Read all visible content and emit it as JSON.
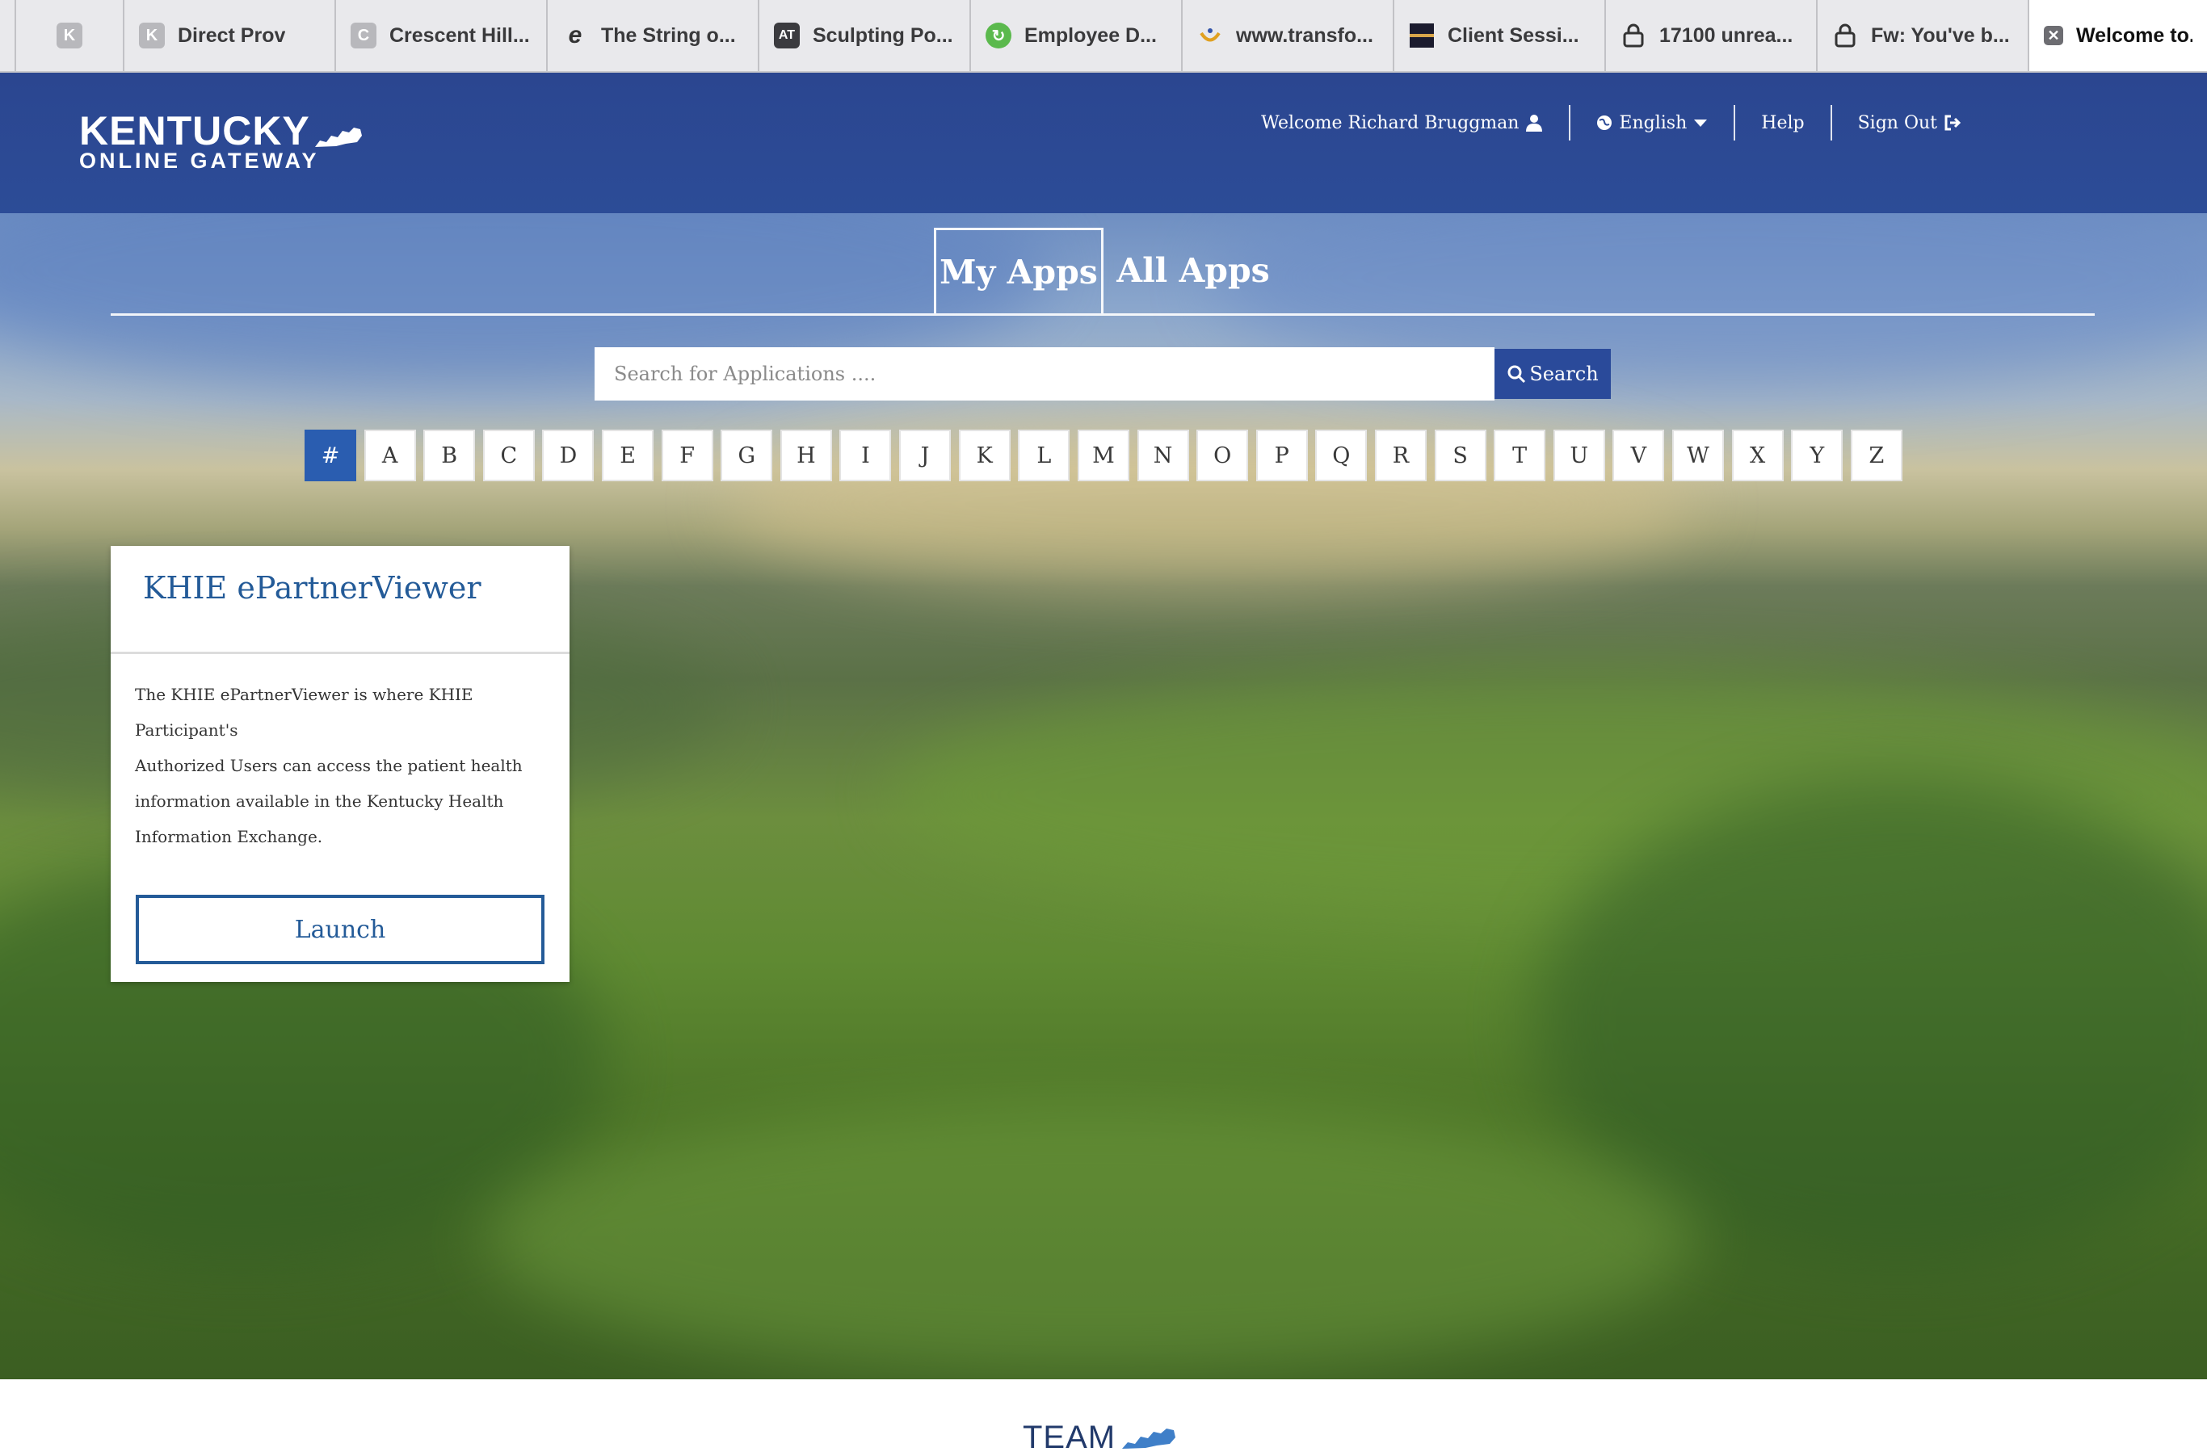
{
  "browser": {
    "tabs": [
      {
        "label": "Direct Prov",
        "icon": "k-icon"
      },
      {
        "label": "Crescent Hill...",
        "icon": "c-icon"
      },
      {
        "label": "The String o...",
        "icon": "script-e-icon"
      },
      {
        "label": "Sculpting Po...",
        "icon": "at-icon"
      },
      {
        "label": "Employee D...",
        "icon": "green-circle-icon"
      },
      {
        "label": "www.transfo...",
        "icon": "smile-icon"
      },
      {
        "label": "Client Sessi...",
        "icon": "photo-icon"
      },
      {
        "label": "17100 unrea...",
        "icon": "lock-icon"
      },
      {
        "label": "Fw: You've b...",
        "icon": "lock-icon"
      },
      {
        "label": "Welcome to...",
        "icon": "close-icon",
        "active": true
      }
    ]
  },
  "header": {
    "logo_line1": "KENTUCKY",
    "logo_line2": "ONLINE GATEWAY",
    "welcome": "Welcome Richard Bruggman",
    "language": "English",
    "help": "Help",
    "sign_out": "Sign Out"
  },
  "apps": {
    "tab_my": "My Apps",
    "tab_all": "All Apps",
    "search_placeholder": "Search for Applications ....",
    "search_button": "Search",
    "letters": [
      "#",
      "A",
      "B",
      "C",
      "D",
      "E",
      "F",
      "G",
      "H",
      "I",
      "J",
      "K",
      "L",
      "M",
      "N",
      "O",
      "P",
      "Q",
      "R",
      "S",
      "T",
      "U",
      "V",
      "W",
      "X",
      "Y",
      "Z"
    ],
    "active_letter": "#"
  },
  "card": {
    "title": "KHIE ePartnerViewer",
    "description_lines": [
      "The KHIE ePartnerViewer is where KHIE Participant's",
      "Authorized Users can access the patient health",
      "information available in the Kentucky Health",
      "Information Exchange."
    ],
    "launch_label": "Launch"
  },
  "footer": {
    "team_label": "TEAM"
  },
  "colors": {
    "header_blue": "#2c4a96",
    "active_letter": "#2a5db0",
    "card_title": "#245b98",
    "search_button": "#2a4a9a"
  }
}
